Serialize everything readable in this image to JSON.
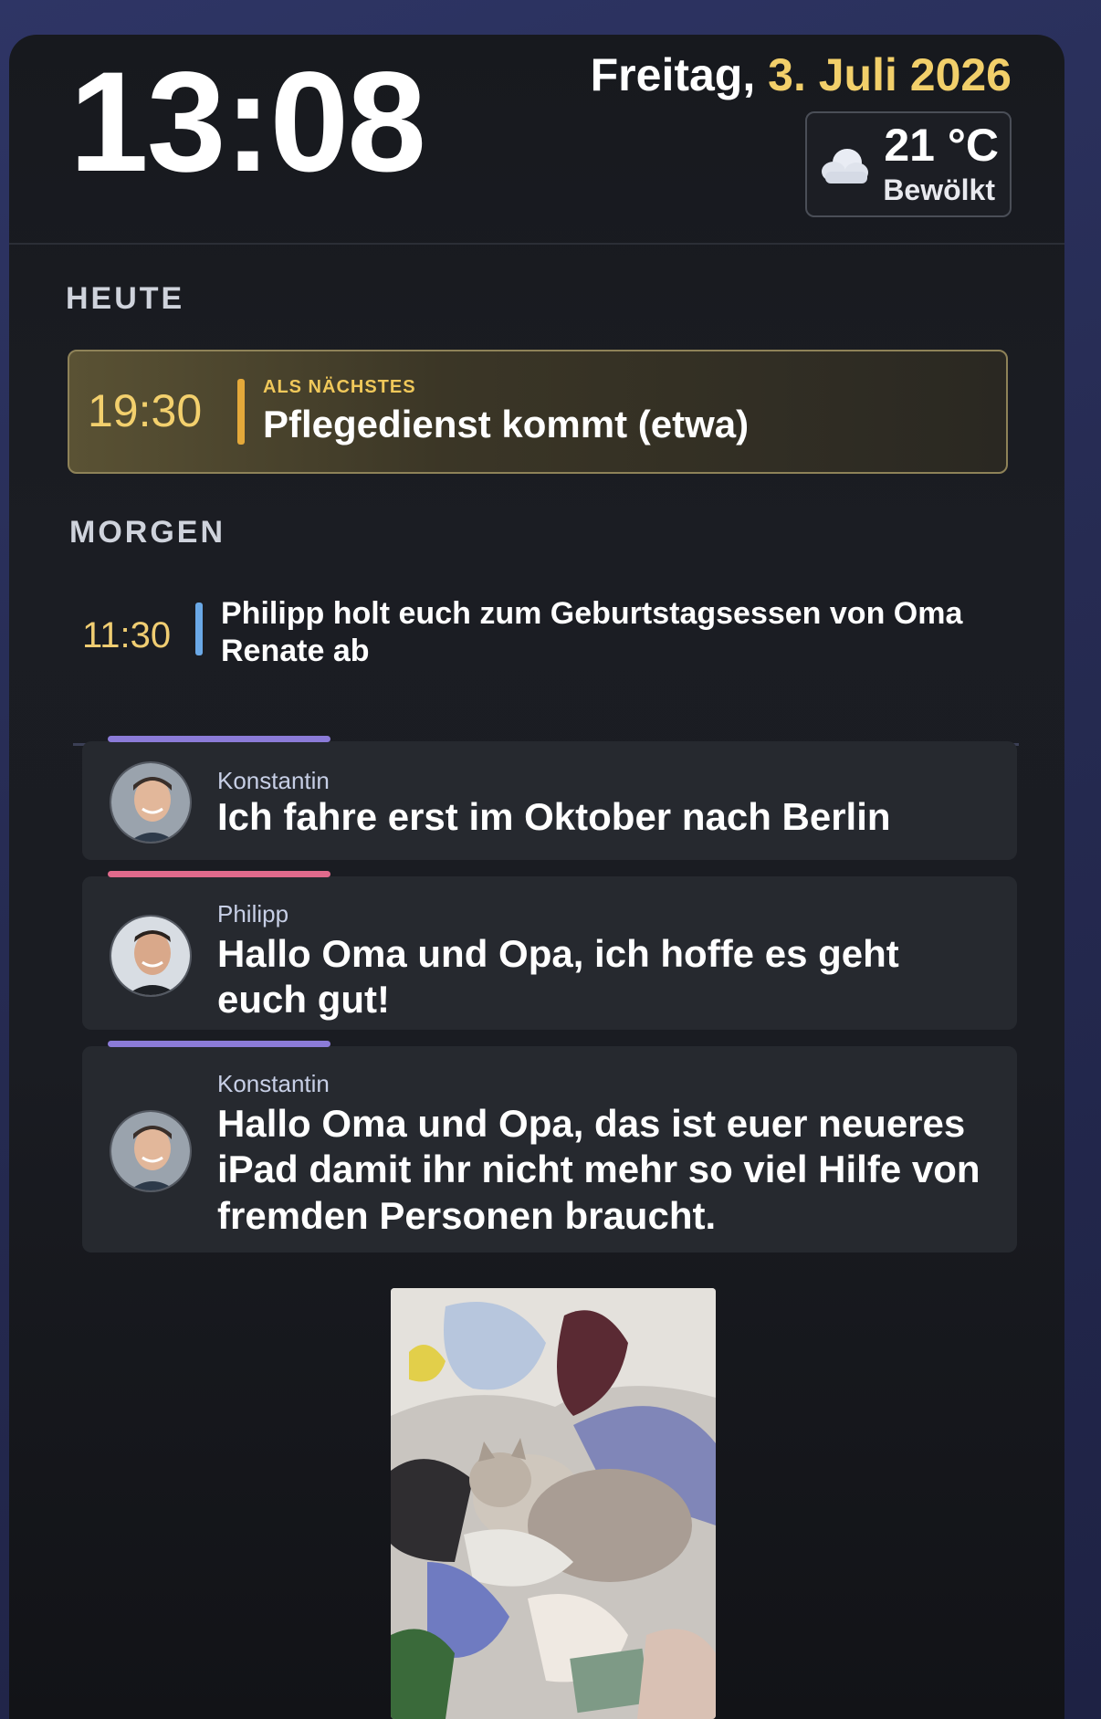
{
  "header": {
    "clock": "13:08",
    "date_weekday": "Freitag,",
    "date_day": "3. Juli 2026",
    "weather": {
      "icon": "cloud-icon",
      "temperature": "21 °C",
      "condition": "Bewölkt"
    }
  },
  "today": {
    "label": "HEUTE",
    "next_event": {
      "caption": "ALS NÄCHSTES",
      "time": "19:30",
      "title": "Pflegedienst kommt (etwa)"
    }
  },
  "tomorrow": {
    "label": "MORGEN",
    "events": [
      {
        "time": "11:30",
        "title": "Philipp holt euch zum Geburtstagsessen von Oma Renate ab"
      }
    ]
  },
  "messages": [
    {
      "sender": "Konstantin",
      "text": "Ich fahre erst im Oktober nach Berlin",
      "accent_color": "#8b7bd8"
    },
    {
      "sender": "Philipp",
      "text": "Hallo Oma und Opa, ich hoffe es geht euch gut!",
      "accent_color": "#e06a8c"
    },
    {
      "sender": "Konstantin",
      "text": "Hallo Oma und Opa, das ist euer neueres iPad damit ihr nicht mehr so viel Hilfe von fremden Personen braucht.",
      "accent_color": "#8b7bd8"
    }
  ],
  "colors": {
    "accent_yellow": "#f2cf6a",
    "event_bar_today": "#e4a93a",
    "event_bar_tomorrow": "#6aa8e6"
  }
}
